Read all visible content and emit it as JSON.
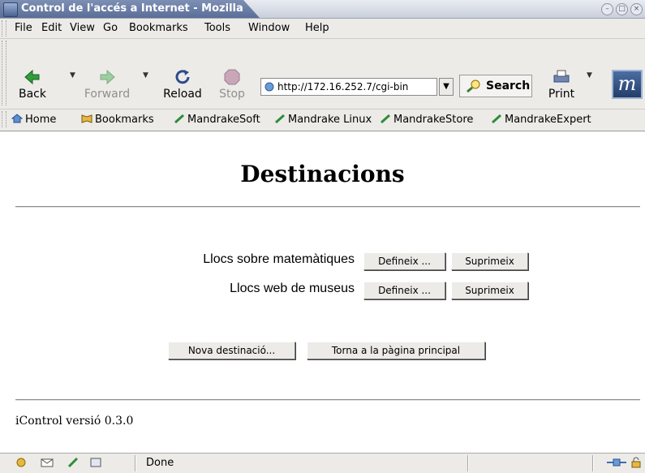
{
  "window": {
    "title": "Control de l'accés a Internet - Mozilla"
  },
  "menubar": {
    "items": [
      "File",
      "Edit",
      "View",
      "Go",
      "Bookmarks",
      "Tools",
      "Window",
      "Help"
    ]
  },
  "navigation": {
    "back": "Back",
    "forward": "Forward",
    "reload": "Reload",
    "stop": "Stop",
    "url": "http://172.16.252.7/cgi-bin",
    "search": "Search",
    "print": "Print"
  },
  "bookmarks": [
    "Home",
    "Bookmarks",
    "MandrakeSoft",
    "Mandrake Linux",
    "MandrakeStore",
    "MandrakeExpert"
  ],
  "page": {
    "heading": "Destinacions",
    "destinations": [
      {
        "label": "Llocs sobre matemàtiques",
        "define": "Defineix ...",
        "delete": "Suprimeix"
      },
      {
        "label": "Llocs web de museus",
        "define": "Defineix ...",
        "delete": "Suprimeix"
      }
    ],
    "new_destination": "Nova destinació...",
    "back_to_main": "Torna a la pàgina principal",
    "footer": "iControl versió 0.3.0"
  },
  "status": {
    "text": "Done"
  },
  "colors": {
    "titlebar_active": "#5a6e98",
    "chrome": "#ecebe8",
    "logo": "#233d6a"
  }
}
